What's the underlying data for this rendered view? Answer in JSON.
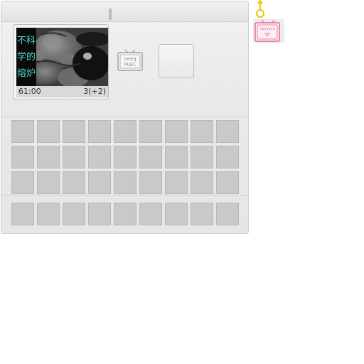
{
  "game_window": {
    "upper_section": {
      "fuel_card": {
        "title_chars": [
          "不科",
          "学的",
          "熔炉"
        ],
        "time": "61:00",
        "count": "3(+2)"
      },
      "need_fuel_icon": {
        "icon": "tv-need-fuel-icon",
        "text_line1": "neeq",
        "text_line2": "FUEl"
      },
      "empty_slot": {
        "state": "empty"
      }
    },
    "inventory": {
      "rows": 3,
      "cols": 9,
      "slot_state": "empty"
    },
    "hotbar": {
      "cols": 9,
      "slot_state": "empty"
    }
  },
  "side_icons": {
    "pin_icon": {
      "icon": "yellow-pin-icon",
      "color": "#f2c200"
    },
    "pink_tv_icon": {
      "icon": "pink-tv-icon",
      "color": "#e8649a"
    }
  }
}
